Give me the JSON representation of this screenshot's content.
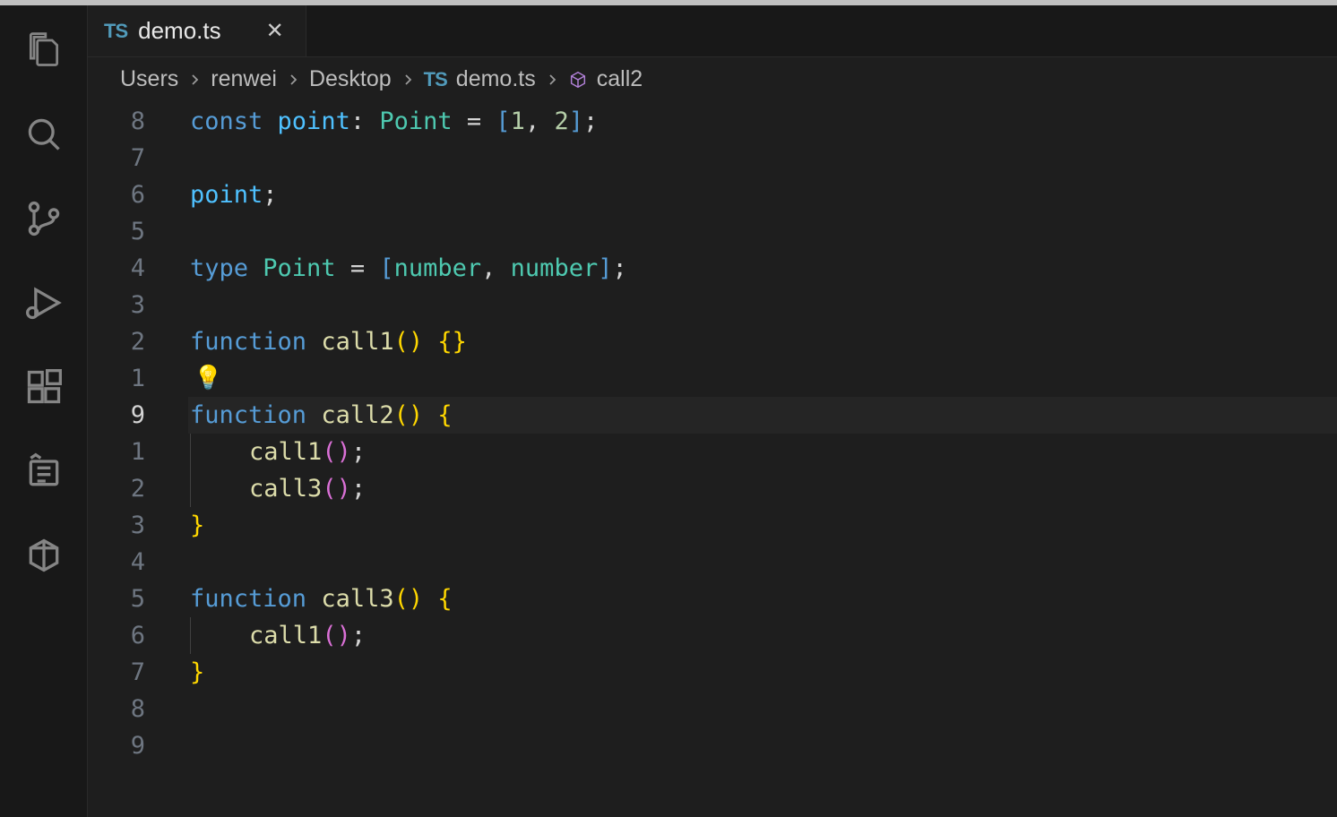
{
  "tab": {
    "icon_label": "TS",
    "label": "demo.ts"
  },
  "breadcrumbs": {
    "items": [
      "Users",
      "renwei",
      "Desktop"
    ],
    "file_icon": "TS",
    "file": "demo.ts",
    "symbol": "call2"
  },
  "editor": {
    "current_line_index": 8,
    "gutter": [
      "8",
      "7",
      "6",
      "5",
      "4",
      "3",
      "2",
      "1",
      "9",
      "1",
      "2",
      "3",
      "4",
      "5",
      "6",
      "7",
      "8",
      "9"
    ],
    "lines": [
      {
        "t": [
          {
            "c": "tk-keyword",
            "v": "const "
          },
          {
            "c": "tk-var",
            "v": "point"
          },
          {
            "c": "tk-punc",
            "v": ": "
          },
          {
            "c": "tk-type",
            "v": "Point"
          },
          {
            "c": "tk-punc",
            "v": " = "
          },
          {
            "c": "tk-bracket",
            "v": "["
          },
          {
            "c": "tk-num",
            "v": "1"
          },
          {
            "c": "tk-punc",
            "v": ", "
          },
          {
            "c": "tk-num",
            "v": "2"
          },
          {
            "c": "tk-bracket",
            "v": "]"
          },
          {
            "c": "tk-punc",
            "v": ";"
          }
        ]
      },
      {
        "t": []
      },
      {
        "t": [
          {
            "c": "tk-var",
            "v": "point"
          },
          {
            "c": "tk-punc",
            "v": ";"
          }
        ]
      },
      {
        "t": []
      },
      {
        "t": [
          {
            "c": "tk-keyword",
            "v": "type "
          },
          {
            "c": "tk-type",
            "v": "Point"
          },
          {
            "c": "tk-punc",
            "v": " = "
          },
          {
            "c": "tk-bracket",
            "v": "["
          },
          {
            "c": "tk-type",
            "v": "number"
          },
          {
            "c": "tk-punc",
            "v": ", "
          },
          {
            "c": "tk-type",
            "v": "number"
          },
          {
            "c": "tk-bracket",
            "v": "]"
          },
          {
            "c": "tk-punc",
            "v": ";"
          }
        ]
      },
      {
        "t": []
      },
      {
        "t": [
          {
            "c": "tk-keyword2",
            "v": "function "
          },
          {
            "c": "tk-func",
            "v": "call1"
          },
          {
            "c": "tk-brace",
            "v": "()"
          },
          {
            "c": "tk-punc",
            "v": " "
          },
          {
            "c": "tk-brace",
            "v": "{}"
          }
        ]
      },
      {
        "bulb": true,
        "t": []
      },
      {
        "current": true,
        "t": [
          {
            "c": "tk-keyword2",
            "v": "function "
          },
          {
            "c": "tk-func",
            "v": "call2"
          },
          {
            "c": "tk-brace",
            "v": "()"
          },
          {
            "c": "tk-punc",
            "v": " "
          },
          {
            "c": "tk-brace",
            "v": "{"
          }
        ]
      },
      {
        "indent": 1,
        "t": [
          {
            "c": "tk-punc",
            "v": "    "
          },
          {
            "c": "tk-func",
            "v": "call1"
          },
          {
            "c": "tk-brace2",
            "v": "()"
          },
          {
            "c": "tk-punc",
            "v": ";"
          }
        ]
      },
      {
        "indent": 1,
        "t": [
          {
            "c": "tk-punc",
            "v": "    "
          },
          {
            "c": "tk-func",
            "v": "call3"
          },
          {
            "c": "tk-brace2",
            "v": "()"
          },
          {
            "c": "tk-punc",
            "v": ";"
          }
        ]
      },
      {
        "t": [
          {
            "c": "tk-brace",
            "v": "}"
          }
        ]
      },
      {
        "t": []
      },
      {
        "t": [
          {
            "c": "tk-keyword2",
            "v": "function "
          },
          {
            "c": "tk-func",
            "v": "call3"
          },
          {
            "c": "tk-brace",
            "v": "()"
          },
          {
            "c": "tk-punc",
            "v": " "
          },
          {
            "c": "tk-brace",
            "v": "{"
          }
        ]
      },
      {
        "indent": 1,
        "t": [
          {
            "c": "tk-punc",
            "v": "    "
          },
          {
            "c": "tk-func",
            "v": "call1"
          },
          {
            "c": "tk-brace2",
            "v": "()"
          },
          {
            "c": "tk-punc",
            "v": ";"
          }
        ]
      },
      {
        "t": [
          {
            "c": "tk-brace",
            "v": "}"
          }
        ]
      },
      {
        "t": []
      },
      {
        "t": []
      }
    ]
  }
}
